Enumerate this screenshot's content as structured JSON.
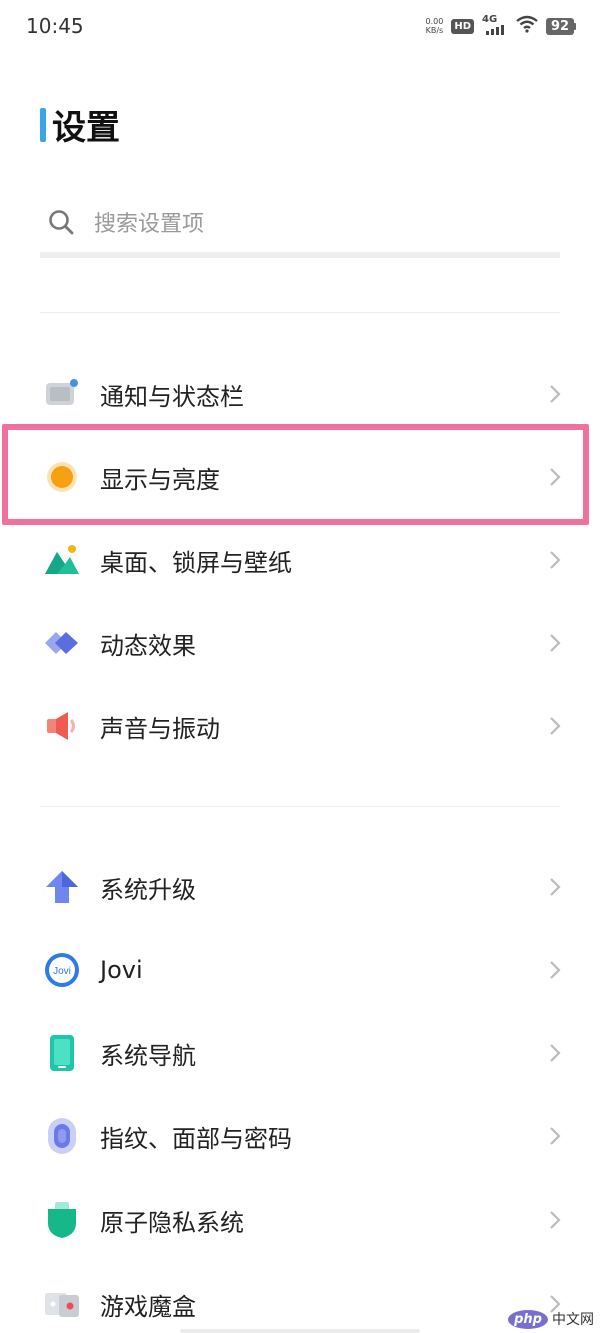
{
  "status_bar": {
    "time": "10:45",
    "speed_value": "0.00",
    "speed_unit": "KB/s",
    "hd_label": "HD",
    "network_label": "4G",
    "battery_level": "92"
  },
  "page": {
    "title": "设置"
  },
  "search": {
    "placeholder": "搜索设置项"
  },
  "colors": {
    "accent": "#3aa5e8",
    "highlight_border": "#f0729a"
  },
  "section1": [
    {
      "label": "通知与状态栏",
      "icon": "notification-icon"
    },
    {
      "label": "显示与亮度",
      "icon": "display-brightness-icon"
    },
    {
      "label": "桌面、锁屏与壁纸",
      "icon": "wallpaper-icon"
    },
    {
      "label": "动态效果",
      "icon": "animation-effects-icon"
    },
    {
      "label": "声音与振动",
      "icon": "sound-icon"
    }
  ],
  "section2": [
    {
      "label": "系统升级",
      "icon": "system-update-icon"
    },
    {
      "label": "Jovi",
      "icon": "jovi-icon",
      "icon_text": "Jovi"
    },
    {
      "label": "系统导航",
      "icon": "system-navigation-icon"
    },
    {
      "label": "指纹、面部与密码",
      "icon": "fingerprint-icon"
    },
    {
      "label": "原子隐私系统",
      "icon": "privacy-shield-icon"
    },
    {
      "label": "游戏魔盒",
      "icon": "game-box-icon"
    }
  ],
  "watermark": {
    "logo": "php",
    "text": "中文网"
  }
}
